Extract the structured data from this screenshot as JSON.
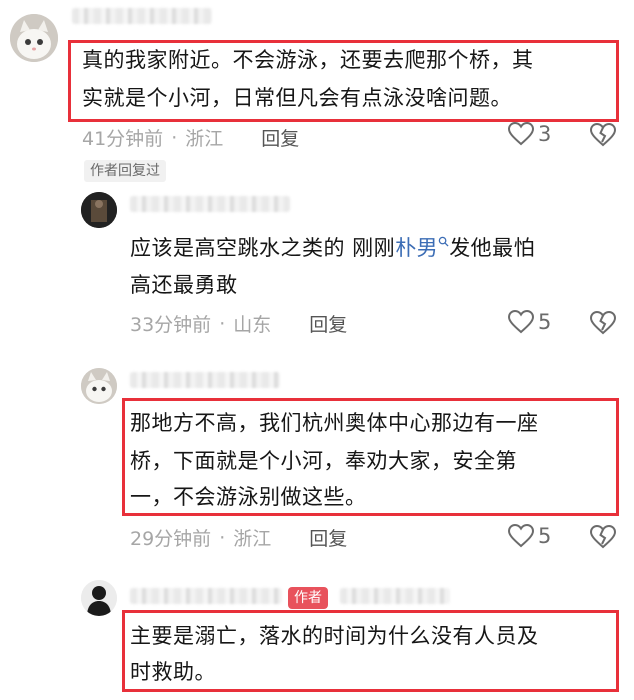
{
  "comments": [
    {
      "text": "真的我家附近。不会游泳，还要去爬那个桥，其实就是个小河，日常但凡会有点泳没啥问题。",
      "line1": "真的我家附近。不会游泳，还要去爬那个桥，其",
      "line2": "实就是个小河，日常但凡会有点泳没啥问题。",
      "time": "41分钟前",
      "location": "浙江",
      "reply": "回复",
      "likes": "3",
      "author_replied_tag": "作者回复过"
    },
    {
      "text_prefix": "应该是高空跳水之类的 刚刚",
      "link": "朴男",
      "text_suffix": "发他最怕",
      "line2": "高还最勇敢",
      "time": "33分钟前",
      "location": "山东",
      "reply": "回复",
      "likes": "5"
    },
    {
      "line1": "那地方不高，我们杭州奥体中心那边有一座",
      "line2": "桥，下面就是个小河，奉劝大家，安全第",
      "line3": "一，不会游泳别做这些。",
      "time": "29分钟前",
      "location": "浙江",
      "reply": "回复",
      "likes": "5"
    },
    {
      "author_tag": "作者",
      "line1": "主要是溺亡，落水的时间为什么没有人员及",
      "line2": "时救助。"
    }
  ],
  "separator": "·",
  "icons": {
    "like": "heart-outline-icon",
    "dislike": "broken-heart-icon",
    "search": "search-icon"
  },
  "colors": {
    "highlight": "#e8303a",
    "link": "#3c6db5",
    "author_tag": "#e8525c"
  }
}
